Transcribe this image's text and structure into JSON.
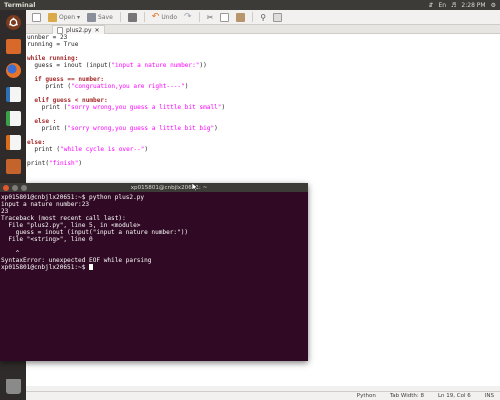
{
  "panel": {
    "title": "Terminal",
    "time": "2:28 PM",
    "keyboard": "En"
  },
  "toolbar": {
    "open_label": "Open",
    "save_label": "Save",
    "undo_label": "Undo"
  },
  "tab": {
    "label": "plus2.py"
  },
  "editor": {
    "lines": [
      "unnber = 23",
      "running = True",
      "",
      "while running:",
      "  guess = inout (input(\"input a nature number:\"))",
      "",
      "  if guess == number:",
      "     print (\"congruation,you are right----\")",
      "",
      "  elif guess < number:",
      "    print (\"sorry wrong,you guess a little bit small\")",
      "",
      "  else :",
      "    print (\"sorry wrong,you guess a little bit big\")",
      "",
      "else:",
      "  print (\"while cycle is over--\")",
      "",
      "print(\"finish\")"
    ]
  },
  "status": {
    "language": "Python",
    "tab_width": "Tab Width: 8",
    "position": "Ln 19, Col 6",
    "mode": "INS"
  },
  "terminal": {
    "title": "xp015801@cnbjlx20651: ~",
    "lines": [
      "xp015801@cnbjlx20651:~$ python plus2.py",
      "input a nature number:23",
      "23",
      "Traceback (most recent call last):",
      "  File \"plus2.py\", line 5, in <module>",
      "    guess = inout (input(\"input a nature number:\"))",
      "  File \"<string>\", line 0",
      "",
      "    ^",
      "SyntaxError: unexpected EOF while parsing",
      "xp015801@cnbjlx20651:~$ "
    ]
  },
  "launcher_items": [
    {
      "name": "dash-home-icon",
      "color": "#7a3b1f"
    },
    {
      "name": "files-icon",
      "color": "#d9682b"
    },
    {
      "name": "firefox-icon",
      "color": "#e8742a"
    },
    {
      "name": "libreoffice-writer-icon",
      "color": "#2f6fb3"
    },
    {
      "name": "libreoffice-calc-icon",
      "color": "#3aa04a"
    },
    {
      "name": "libreoffice-impress-icon",
      "color": "#d96d1c"
    },
    {
      "name": "software-center-icon",
      "color": "#c5632c"
    },
    {
      "name": "ubuntu-one-icon",
      "color": "#b03a2e"
    },
    {
      "name": "system-settings-icon",
      "color": "#9a9a9a"
    },
    {
      "name": "terminal-icon",
      "color": "#3a3a3a"
    },
    {
      "name": "text-editor-icon",
      "color": "#b9b9b9"
    },
    {
      "name": "workspace-switcher-icon",
      "color": "#5a5a5a"
    },
    {
      "name": "trash-icon",
      "color": "#8a8a8a"
    }
  ]
}
